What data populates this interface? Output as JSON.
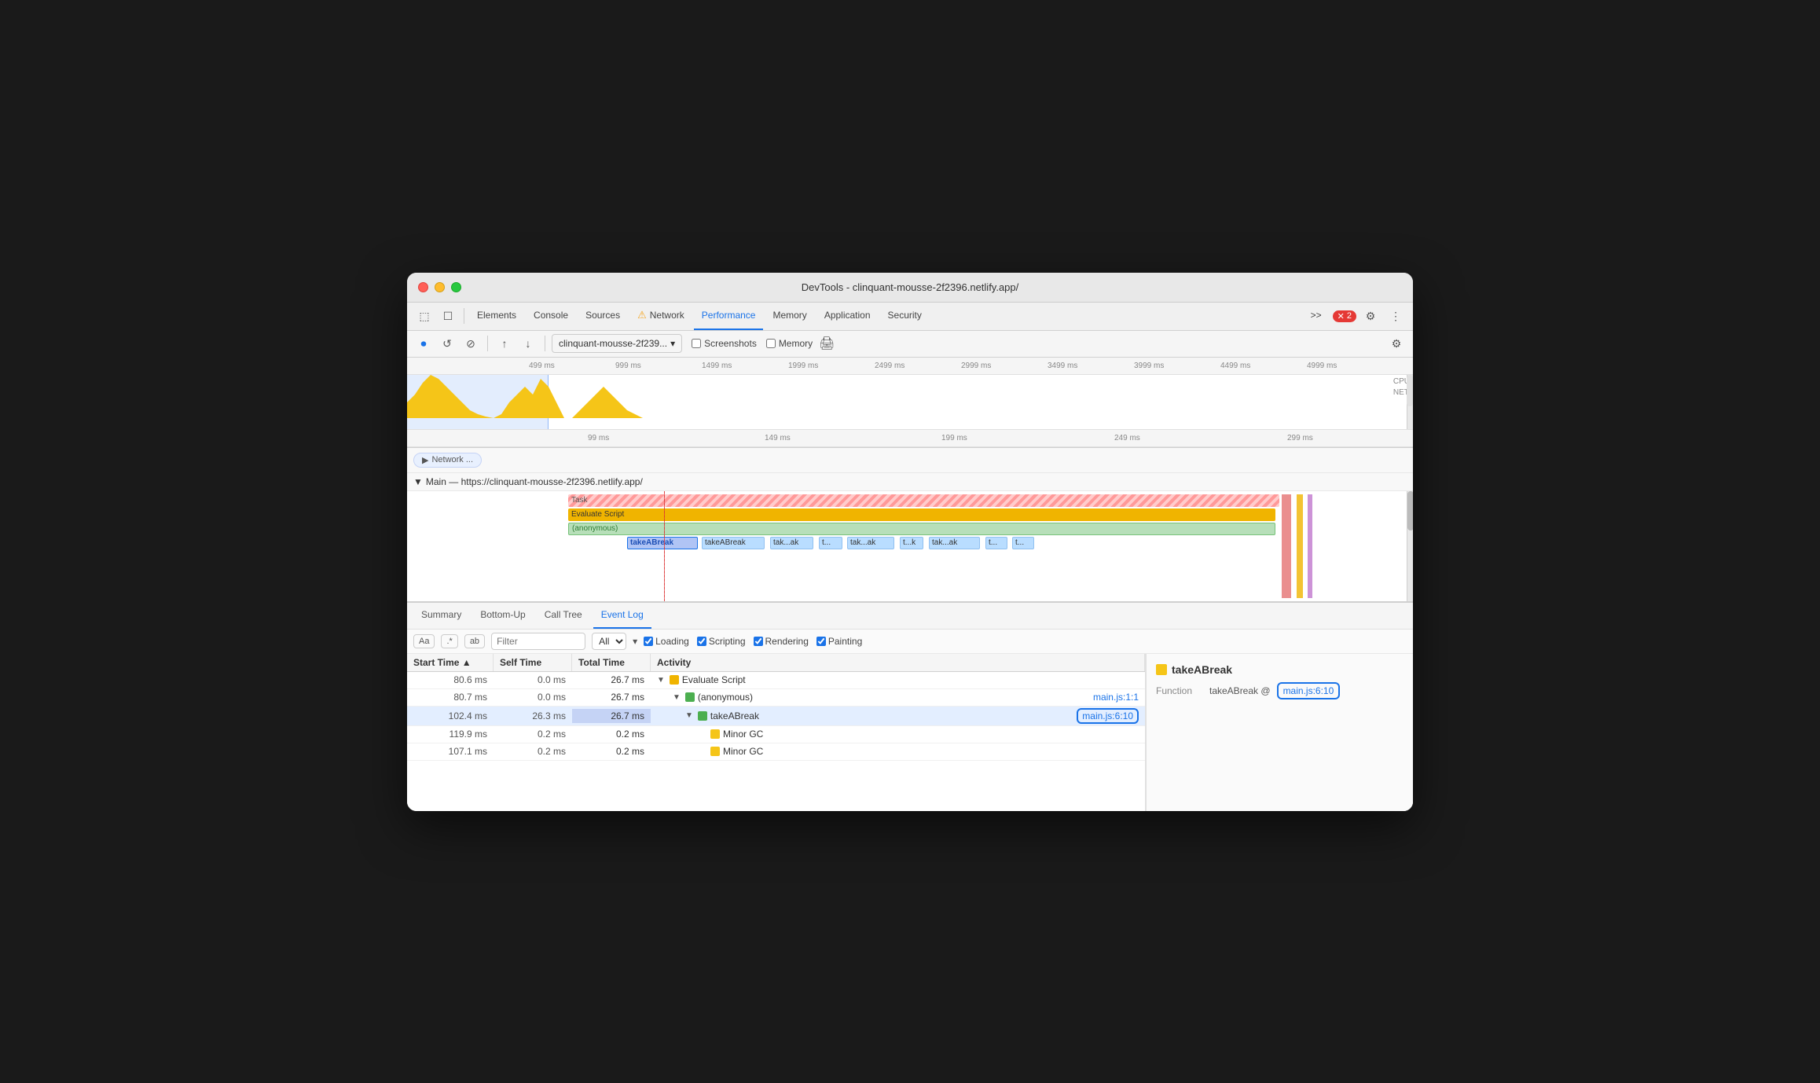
{
  "window": {
    "title": "DevTools - clinquant-mousse-2f2396.netlify.app/"
  },
  "traffic_lights": {
    "close": "close",
    "minimize": "minimize",
    "maximize": "maximize"
  },
  "devtools_tabs": {
    "icons": [
      {
        "name": "inspect-icon",
        "symbol": "⬚",
        "tooltip": "Inspect element"
      },
      {
        "name": "device-icon",
        "symbol": "⬜",
        "tooltip": "Toggle device"
      }
    ],
    "tabs": [
      {
        "id": "elements",
        "label": "Elements",
        "active": false
      },
      {
        "id": "console",
        "label": "Console",
        "active": false
      },
      {
        "id": "sources",
        "label": "Sources",
        "active": false
      },
      {
        "id": "network",
        "label": "Network",
        "active": false,
        "warning": true
      },
      {
        "id": "performance",
        "label": "Performance",
        "active": true
      },
      {
        "id": "memory",
        "label": "Memory",
        "active": false
      },
      {
        "id": "application",
        "label": "Application",
        "active": false
      },
      {
        "id": "security",
        "label": "Security",
        "active": false
      }
    ],
    "more_tabs": ">>",
    "error_count": "2",
    "settings_tooltip": "Settings",
    "more_options": "⋮"
  },
  "toolbar": {
    "record_label": "Record",
    "reload_label": "Reload",
    "clear_label": "Clear",
    "upload_label": "Upload",
    "download_label": "Download",
    "url_value": "clinquant-mousse-2f239...",
    "screenshots_label": "Screenshots",
    "memory_label": "Memory",
    "settings_label": "Capture settings"
  },
  "timeline_ruler": {
    "ticks": [
      "499 ms",
      "999 ms",
      "1499 ms",
      "1999 ms",
      "2499 ms",
      "2999 ms",
      "3499 ms",
      "3999 ms",
      "4499 ms",
      "4999 ms"
    ],
    "labels": [
      "CPU",
      "NET"
    ]
  },
  "timeline_ruler2": {
    "ticks": [
      "99 ms",
      "149 ms",
      "199 ms",
      "249 ms",
      "299 ms"
    ]
  },
  "flame_chart": {
    "network_label": "Network ...",
    "main_label": "Main — https://clinquant-mousse-2f2396.netlify.app/",
    "task_label": "Task",
    "evaluate_label": "Evaluate Script",
    "anonymous_label": "(anonymous)",
    "take_break_bars": [
      "takeABreak",
      "takeABreak",
      "tak...ak",
      "t...",
      "tak...ak",
      "t...k",
      "tak...ak",
      "t...",
      "t..."
    ]
  },
  "bottom_tabs": {
    "tabs": [
      {
        "id": "summary",
        "label": "Summary",
        "active": false
      },
      {
        "id": "bottom-up",
        "label": "Bottom-Up",
        "active": false
      },
      {
        "id": "call-tree",
        "label": "Call Tree",
        "active": false
      },
      {
        "id": "event-log",
        "label": "Event Log",
        "active": true
      }
    ]
  },
  "filter_bar": {
    "aa_label": "Aa",
    "dot_label": ".*",
    "ab_label": "ab",
    "filter_placeholder": "Filter",
    "all_label": "All",
    "loading_label": "Loading",
    "scripting_label": "Scripting",
    "rendering_label": "Rendering",
    "painting_label": "Painting"
  },
  "table": {
    "headers": [
      "Start Time",
      "Self Time",
      "Total Time",
      "Activity"
    ],
    "sort_indicator": "▲",
    "rows": [
      {
        "start_time": "80.6 ms",
        "self_time": "0.0 ms",
        "total_time": "26.7 ms",
        "total_time_highlight": false,
        "activity": "Evaluate Script",
        "indent": 0,
        "has_expand": true,
        "color": "yellow",
        "link": ""
      },
      {
        "start_time": "80.7 ms",
        "self_time": "0.0 ms",
        "total_time": "26.7 ms",
        "total_time_highlight": false,
        "activity": "(anonymous)",
        "indent": 1,
        "has_expand": true,
        "color": "green",
        "link": "main.js:1:1"
      },
      {
        "start_time": "102.4 ms",
        "self_time": "26.3 ms",
        "total_time": "26.7 ms",
        "total_time_highlight": true,
        "activity": "takeABreak",
        "indent": 2,
        "has_expand": true,
        "color": "green",
        "link": "main.js:6:10",
        "link_circled": true
      },
      {
        "start_time": "119.9 ms",
        "self_time": "0.2 ms",
        "total_time": "0.2 ms",
        "total_time_highlight": false,
        "activity": "Minor GC",
        "indent": 3,
        "has_expand": false,
        "color": "yellow",
        "link": ""
      },
      {
        "start_time": "107.1 ms",
        "self_time": "0.2 ms",
        "total_time": "0.2 ms",
        "total_time_highlight": false,
        "activity": "Minor GC",
        "indent": 3,
        "has_expand": false,
        "color": "yellow",
        "link": ""
      }
    ]
  },
  "detail_panel": {
    "title": "takeABreak",
    "function_label": "Function",
    "function_value": "takeABreak @",
    "function_link": "main.js:6:10",
    "color": "yellow"
  }
}
